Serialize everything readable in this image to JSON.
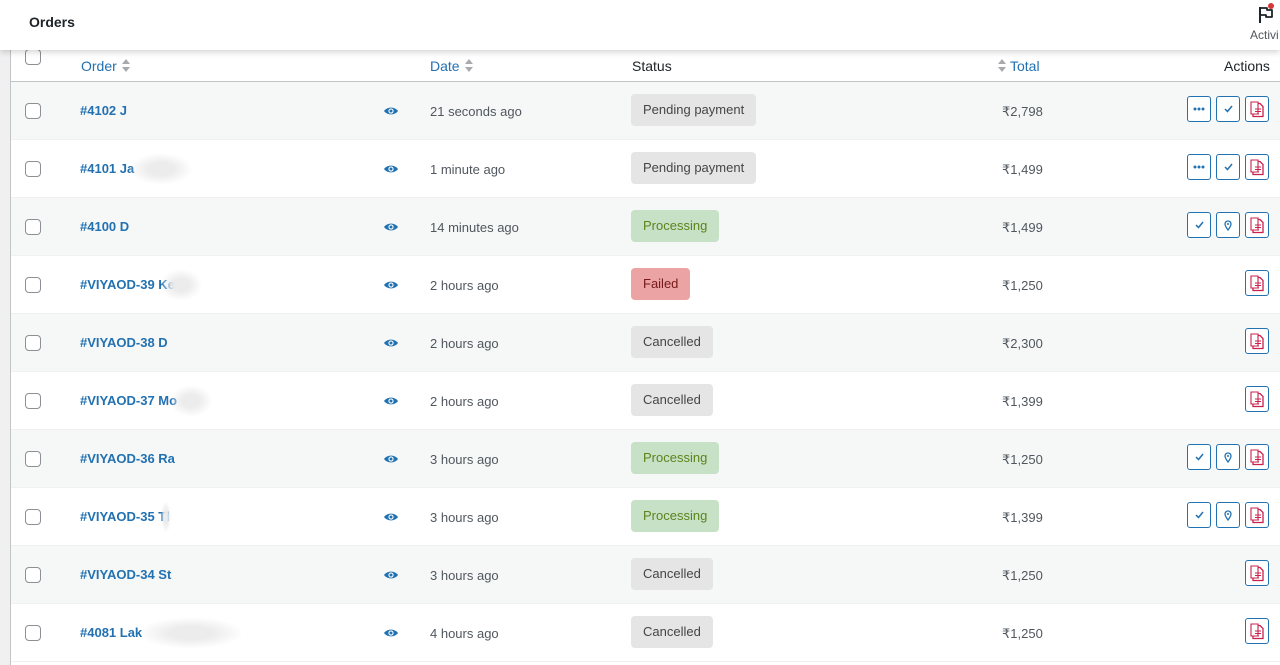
{
  "header": {
    "title": "Orders",
    "activity_label": "Activi"
  },
  "columns": {
    "order": "Order",
    "date": "Date",
    "status": "Status",
    "total": "Total",
    "actions": "Actions"
  },
  "colors": {
    "link": "#2271b1",
    "pending_bg": "#e5e5e5",
    "processing_bg": "#c6e1c6",
    "processing_fg": "#5b841b",
    "failed_bg": "#eba3a3",
    "failed_fg": "#761919",
    "cancelled_bg": "#e5e5e5",
    "pdf_icon": "#c9214b"
  },
  "orders": [
    {
      "order": "#4102 J",
      "date": "21 seconds ago",
      "status": "Pending payment",
      "status_type": "pending",
      "total": "₹2,798",
      "actions": [
        "more-icon",
        "check-icon",
        "pdf-invoice-icon"
      ]
    },
    {
      "order": "#4101 Ja",
      "date": "1 minute ago",
      "status": "Pending payment",
      "status_type": "pending",
      "total": "₹1,499",
      "actions": [
        "more-icon",
        "check-icon",
        "pdf-invoice-icon"
      ]
    },
    {
      "order": "#4100 D",
      "date": "14 minutes ago",
      "status": "Processing",
      "status_type": "processing",
      "total": "₹1,499",
      "actions": [
        "check-icon",
        "location-pin-icon",
        "pdf-invoice-icon"
      ]
    },
    {
      "order": "#VIYAOD-39 Ke",
      "date": "2 hours ago",
      "status": "Failed",
      "status_type": "failed",
      "total": "₹1,250",
      "actions": [
        "pdf-invoice-icon"
      ]
    },
    {
      "order": "#VIYAOD-38 D",
      "date": "2 hours ago",
      "status": "Cancelled",
      "status_type": "cancelled",
      "total": "₹2,300",
      "actions": [
        "pdf-invoice-icon"
      ]
    },
    {
      "order": "#VIYAOD-37 Mo",
      "date": "2 hours ago",
      "status": "Cancelled",
      "status_type": "cancelled",
      "total": "₹1,399",
      "actions": [
        "pdf-invoice-icon"
      ]
    },
    {
      "order": "#VIYAOD-36 Ra",
      "date": "3 hours ago",
      "status": "Processing",
      "status_type": "processing",
      "total": "₹1,250",
      "actions": [
        "check-icon",
        "location-pin-icon",
        "pdf-invoice-icon"
      ]
    },
    {
      "order": "#VIYAOD-35 Tl",
      "date": "3 hours ago",
      "status": "Processing",
      "status_type": "processing",
      "total": "₹1,399",
      "actions": [
        "check-icon",
        "location-pin-icon",
        "pdf-invoice-icon"
      ]
    },
    {
      "order": "#VIYAOD-34 St",
      "date": "3 hours ago",
      "status": "Cancelled",
      "status_type": "cancelled",
      "total": "₹1,250",
      "actions": [
        "pdf-invoice-icon"
      ]
    },
    {
      "order": "#4081 Lak",
      "date": "4 hours ago",
      "status": "Cancelled",
      "status_type": "cancelled",
      "total": "₹1,250",
      "actions": [
        "pdf-invoice-icon"
      ]
    }
  ]
}
